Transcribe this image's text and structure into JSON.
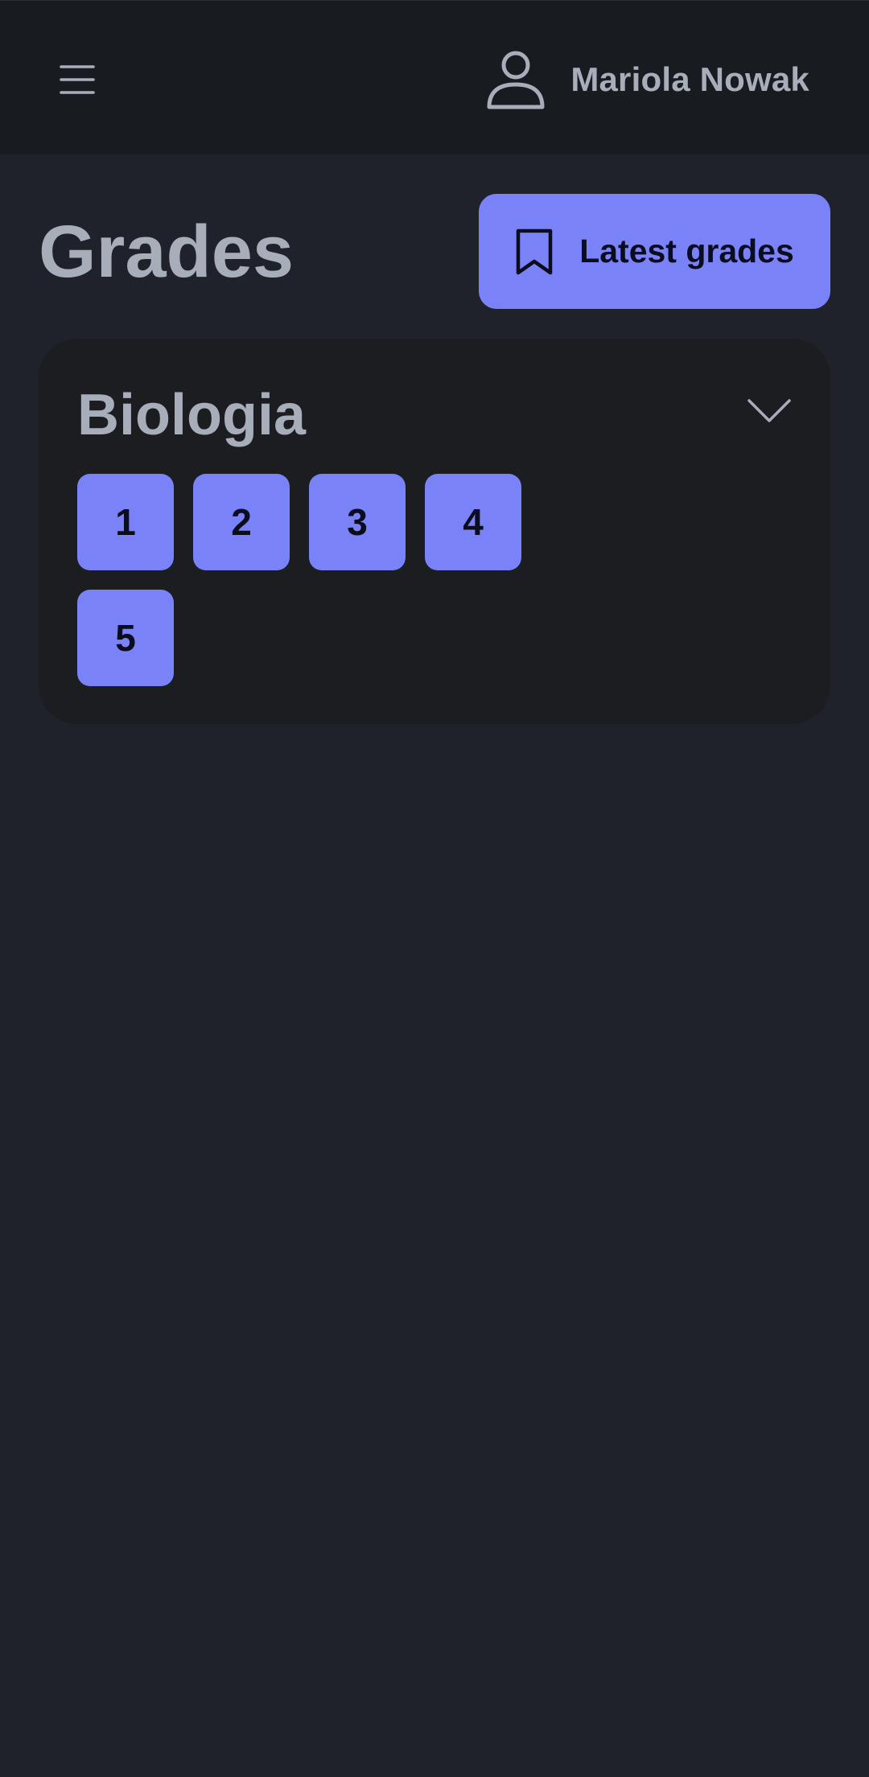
{
  "header": {
    "menu_icon": "hamburger-menu-icon",
    "user_icon": "user-icon",
    "user_name": "Mariola Nowak"
  },
  "page": {
    "title": "Grades",
    "latest_button": {
      "icon": "bookmark-icon",
      "label": "Latest grades"
    }
  },
  "subjects": [
    {
      "name": "Biologia",
      "expand_icon": "chevron-down-icon",
      "grades": [
        "1",
        "2",
        "3",
        "4",
        "5"
      ]
    }
  ],
  "colors": {
    "background": "#1f222a",
    "topbar": "#181b20",
    "card": "#1b1d21",
    "accent": "#7a82f7",
    "text_muted": "#a8adba",
    "text_on_accent": "#0b0d1e"
  }
}
